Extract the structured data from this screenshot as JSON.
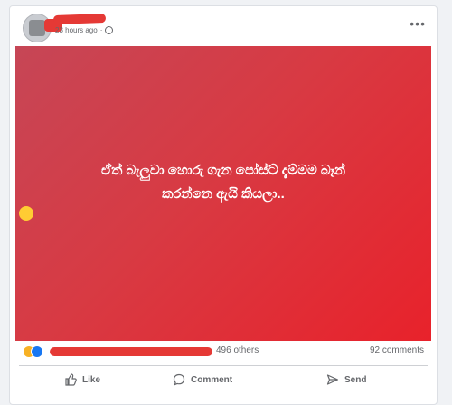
{
  "post": {
    "timestamp": "23 hours ago",
    "privacy_icon": "globe-icon",
    "more_icon": "more-options-icon",
    "text_line1": "ඒත් බැලුවා හොරු ගැන පෝස්ට් දැම්මම බෑන්",
    "text_line2": "කරන්නෙ ඇයි කියලා..",
    "background_colors": [
      "#c64656",
      "#e8222b"
    ]
  },
  "reactions": {
    "others": "496 others",
    "comments": "92 comments"
  },
  "actions": {
    "like": "Like",
    "comment": "Comment",
    "send": "Send"
  }
}
